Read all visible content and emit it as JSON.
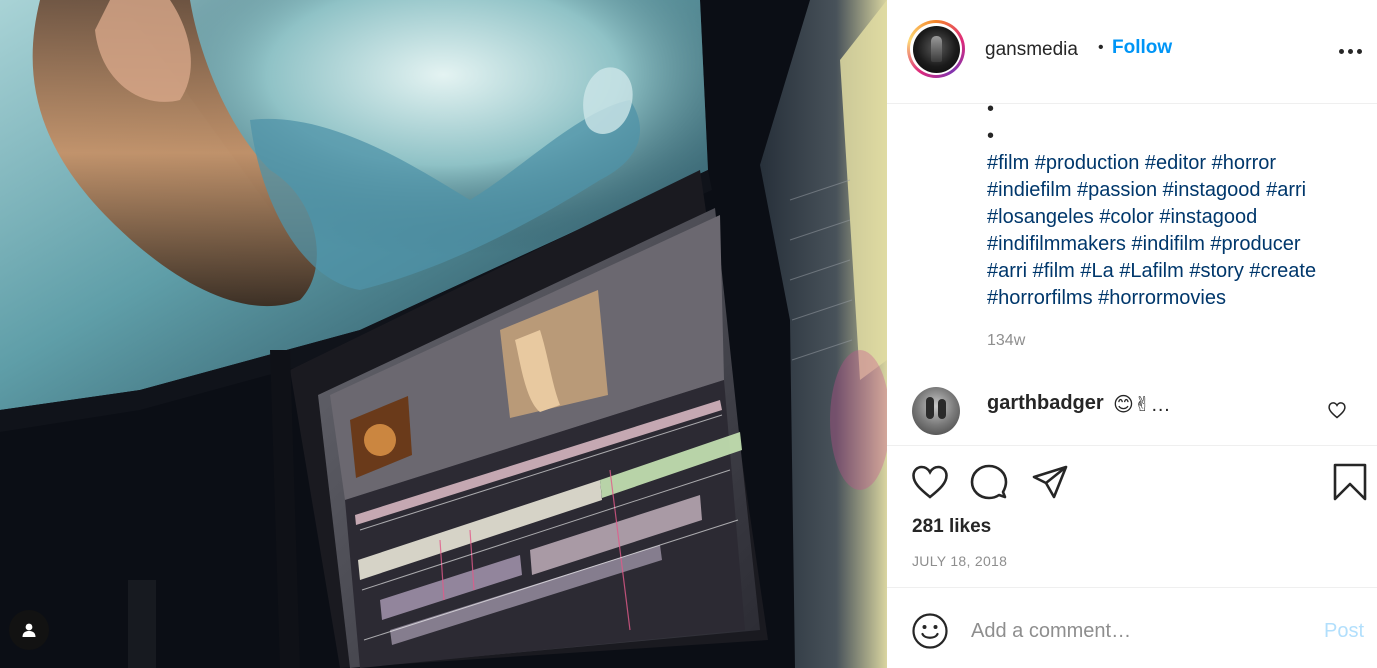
{
  "post": {
    "username": "gansmedia",
    "separator": "•",
    "follow_label": "Follow",
    "caption_bullets": [
      "•",
      "•"
    ],
    "hashtags": [
      "#film",
      "#production",
      "#editor",
      "#horror",
      "#indiefilm",
      "#passion",
      "#instagood",
      "#arri",
      "#losangeles",
      "#color",
      "#instagood",
      "#indifilmmakers",
      "#indifilm",
      "#producer",
      "#arri",
      "#film",
      "#La",
      "#Lafilm",
      "#story",
      "#create",
      "#horrorfilms",
      "#horrormovies"
    ],
    "time_ago": "134w"
  },
  "comment": {
    "username": "garthbadger",
    "text": "😊✌…"
  },
  "actions": {
    "like_icon": "heart-icon",
    "comment_icon": "comment-bubble-icon",
    "share_icon": "paper-plane-icon",
    "save_icon": "bookmark-icon"
  },
  "stats": {
    "likes": "281 likes",
    "date": "JULY 18, 2018"
  },
  "add_comment": {
    "placeholder": "Add a comment…",
    "post_label": "Post"
  },
  "colors": {
    "follow": "#0095f6",
    "post_disabled": "#b2dffc",
    "hashtag": "#00376b",
    "muted": "#8e8e8e"
  }
}
